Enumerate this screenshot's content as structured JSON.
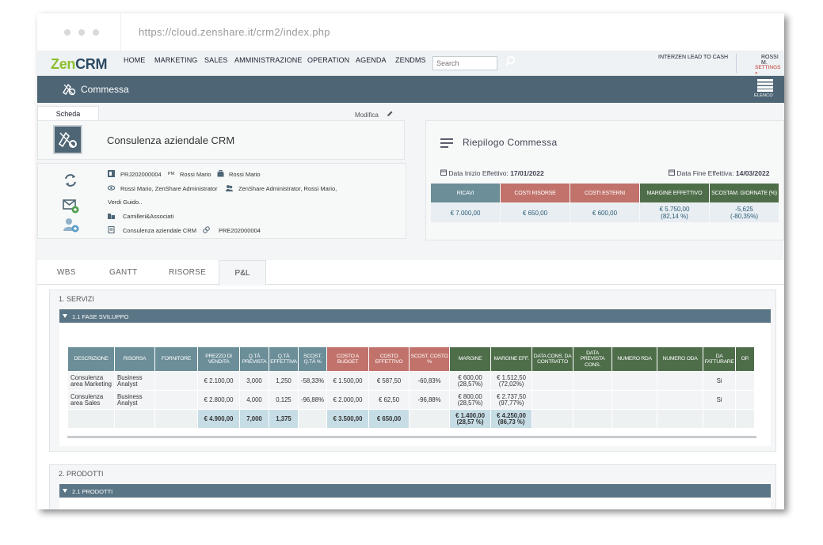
{
  "browser": {
    "url": "https://cloud.zenshare.it/crm2/index.php"
  },
  "logo": {
    "zen": "Zen",
    "crm": "CRM"
  },
  "nav": [
    "HOME",
    "MARKETING",
    "SALES",
    "AMMINISTRAZIONE",
    "OPERATION",
    "AGENDA",
    "ZENDMS"
  ],
  "search": {
    "placeholder": "Search"
  },
  "topright": {
    "lead": "INTERZEN LEAD TO CASH",
    "user": "ROSSI M.",
    "settings": "SETTINGS »"
  },
  "titlebar": {
    "title": "Commessa",
    "elenco": "ELENCO"
  },
  "scheda": {
    "tab": "Scheda",
    "modifica": "Modifica"
  },
  "project": {
    "title": "Consulenza aziendale CRM",
    "code": "PRJ202000004",
    "pm_label": "PM",
    "pm": "Rossi Mario",
    "owner": "Rossi Mario",
    "viewers": "Rossi Mario, ZenShare Administrator",
    "team": "ZenShare Administrator, Rossi Mario,",
    "team_more": "Verdi Guido..",
    "company": "Camilleri&Associati",
    "deal": "Consulenza aziendale CRM",
    "deal_code": "PRE202000004"
  },
  "riepilogo": {
    "title": "Riepilogo Commessa",
    "start_label": "Data Inizio Effettivo:",
    "start": "17/01/2022",
    "end_label": "Data Fine Effettiva:",
    "end": "14/03/2022",
    "headers": [
      "RICAVI",
      "COSTI RISORSE",
      "COSTI ESTERNI",
      "MARGINE EFFETTIVO",
      "SCOSTAM. GIORNATE (%)"
    ],
    "values": [
      "€ 7.000,00",
      "€ 650,00",
      "€ 600,00",
      "€ 5.750,00",
      "-5,625"
    ],
    "values2": [
      "",
      "",
      "",
      "(82,14 %)",
      "(-80,35%)"
    ]
  },
  "tabs": [
    "WBS",
    "GANTT",
    "RISORSE",
    "P&L"
  ],
  "section1": {
    "title": "1. SERVIZI",
    "sub": "1.1 FASE SVILUPPO",
    "headers": [
      "DESCRIZIONE",
      "RISORSA",
      "FORNITORE",
      "PREZZO DI VENDITA",
      "Q.TÀ PREVISTA",
      "Q.TÀ EFFETTIVA",
      "SCOST. Q.TÀ %",
      "COSTO A BUDGET",
      "COSTO EFFETTIVO",
      "SCOST. COSTO %",
      "MARGINE",
      "MARGINE EFF.",
      "DATA CONS. DA CONTRATTO",
      "DATA PREVISTA CONS.",
      "NUMERO RDA",
      "NUMERO ODA",
      "DA FATTURARE",
      "OP."
    ],
    "rows": [
      {
        "desc": "Consulenza area Marketing",
        "risorsa": "Business Analyst",
        "fornitore": "",
        "prezzo": "€ 2.100,00",
        "qprev": "3,000",
        "qeff": "1,250",
        "scostq": "-58,33%",
        "budget": "€ 1.500,00",
        "costo": "€ 587,50",
        "scostc": "-60,83%",
        "margine": "€ 600,00",
        "margine2": "(28,57%)",
        "meff": "€ 1.512,50",
        "meff2": "(72,02%)",
        "fatt": "Si"
      },
      {
        "desc": "Consulenza area Sales",
        "risorsa": "Business Analyst",
        "fornitore": "",
        "prezzo": "€ 2.800,00",
        "qprev": "4,000",
        "qeff": "0,125",
        "scostq": "-96,88%",
        "budget": "€ 2.000,00",
        "costo": "€ 62,50",
        "scostc": "-96,88%",
        "margine": "€ 800,00",
        "margine2": "(28,57%)",
        "meff": "€ 2.737,50",
        "meff2": "(97,77%)",
        "fatt": "Si"
      }
    ],
    "total": {
      "prezzo": "€ 4.900,00",
      "qprev": "7,000",
      "qeff": "1,375",
      "budget": "€ 3.500,00",
      "costo": "€ 650,00",
      "margine": "€ 1.400,00",
      "margine2": "(28,57 %)",
      "meff": "€ 4.250,00",
      "meff2": "(86,73 %)"
    }
  },
  "section2": {
    "title": "2. PRODOTTI",
    "sub": "2.1 PRODOTTI"
  },
  "colors": {
    "header_bar": "#4d6575",
    "accent_green": "#8dbf2f",
    "col_teal": "#6b8e98",
    "col_red": "#c1726b",
    "col_dark_green": "#4e6e4a"
  }
}
